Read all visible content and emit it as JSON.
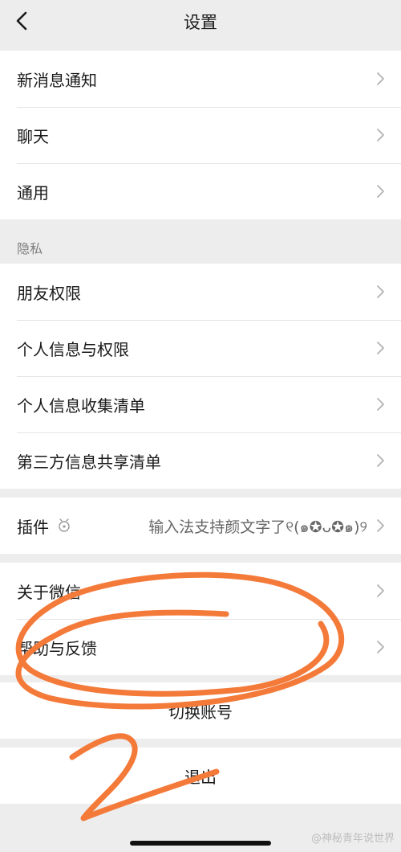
{
  "header": {
    "title": "设置"
  },
  "general": {
    "items": [
      "新消息通知",
      "聊天",
      "通用"
    ]
  },
  "privacy": {
    "label": "隐私",
    "items": [
      "朋友权限",
      "个人信息与权限",
      "个人信息收集清单",
      "第三方信息共享清单"
    ]
  },
  "plugins": {
    "label": "插件",
    "description": "输入法支持颜文字了୧(๑✪ᴗ✪๑)୨"
  },
  "about": {
    "items": [
      "关于微信",
      "帮助与反馈"
    ]
  },
  "account": {
    "switch_label": "切换账号",
    "logout_label": "退出"
  },
  "watermark": "@神秘青年说世界",
  "annotation": {
    "stroke_color": "#f47a3a"
  }
}
